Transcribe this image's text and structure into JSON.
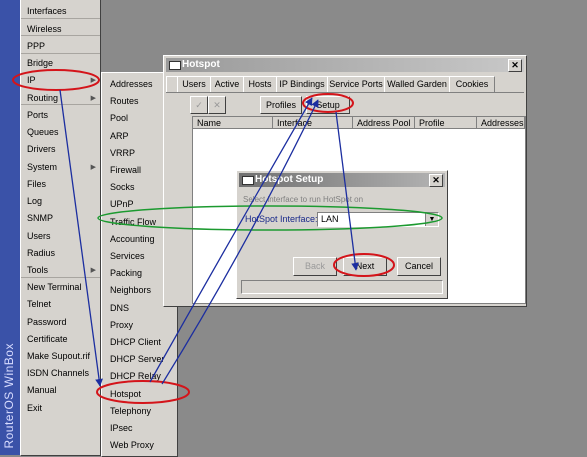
{
  "branding": {
    "vertical_label": "RouterOS WinBox"
  },
  "main_menu": [
    {
      "label": "Interfaces"
    },
    {
      "label": "Wireless"
    },
    {
      "label": "PPP"
    },
    {
      "label": "Bridge"
    },
    {
      "label": "IP",
      "submenu": true
    },
    {
      "label": "Routing",
      "submenu": true
    },
    {
      "label": "Ports"
    },
    {
      "label": "Queues"
    },
    {
      "label": "Drivers"
    },
    {
      "label": "System",
      "submenu": true
    },
    {
      "label": "Files"
    },
    {
      "label": "Log"
    },
    {
      "label": "SNMP"
    },
    {
      "label": "Users"
    },
    {
      "label": "Radius"
    },
    {
      "label": "Tools",
      "submenu": true
    },
    {
      "label": "New Terminal"
    },
    {
      "label": "Telnet"
    },
    {
      "label": "Password"
    },
    {
      "label": "Certificate"
    },
    {
      "label": "Make Supout.rif"
    },
    {
      "label": "ISDN Channels"
    },
    {
      "label": "Manual"
    },
    {
      "label": "Exit"
    }
  ],
  "ip_submenu": [
    "Addresses",
    "Routes",
    "Pool",
    "ARP",
    "VRRP",
    "Firewall",
    "Socks",
    "UPnP",
    "Traffic Flow",
    "Accounting",
    "Services",
    "Packing",
    "Neighbors",
    "DNS",
    "Proxy",
    "DHCP Client",
    "DHCP Server",
    "DHCP Relay",
    "Hotspot",
    "Telephony",
    "IPsec",
    "Web Proxy"
  ],
  "hotspot_window": {
    "title": "Hotspot",
    "close": "✕",
    "tabs": [
      "Users",
      "Active",
      "Hosts",
      "IP Bindings",
      "Service Ports",
      "Walled Garden",
      "Cookies"
    ],
    "toolbar": {
      "check": "✓",
      "cross": "✕",
      "profiles": "Profiles",
      "setup": "Setup"
    },
    "columns": [
      "Name",
      "Interface",
      "Address Pool",
      "Profile",
      "Addresses"
    ]
  },
  "setup_dialog": {
    "title": "Hotspot Setup",
    "close": "✕",
    "hint": "Select interface to run HotSpot on",
    "field_label": "HotSpot Interface:",
    "field_value": "LAN",
    "dropdown": "▼",
    "buttons": {
      "back": "Back",
      "next": "Next",
      "cancel": "Cancel"
    }
  },
  "colors": {
    "annotation": "#d4141a",
    "arrows": "#1c2ea0",
    "accent": "#3a52a8"
  }
}
